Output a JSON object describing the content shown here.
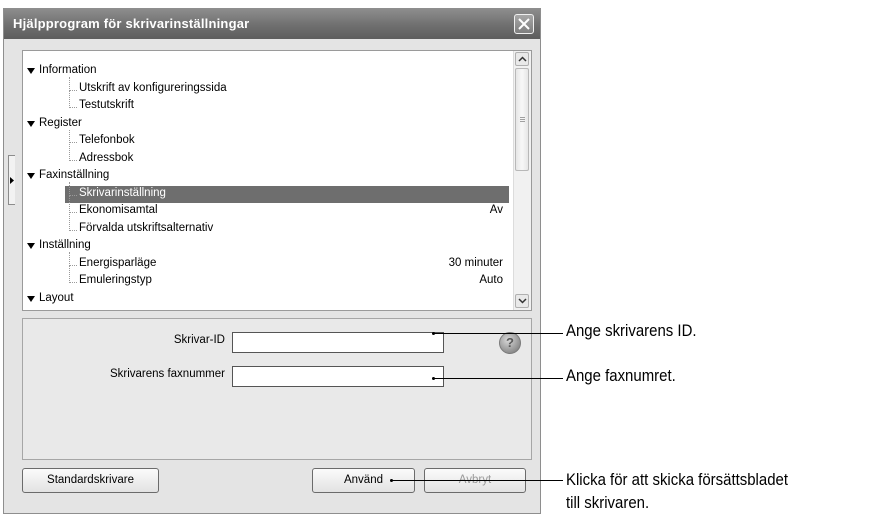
{
  "window": {
    "title": "Hjälpprogram för skrivarinställningar"
  },
  "tree": {
    "items": [
      {
        "label": "Information",
        "value": "",
        "level": 0
      },
      {
        "label": "Utskrift av konfigureringssida",
        "value": "",
        "level": 1
      },
      {
        "label": "Testutskrift",
        "value": "",
        "level": 1
      },
      {
        "label": "Register",
        "value": "",
        "level": 0
      },
      {
        "label": "Telefonbok",
        "value": "",
        "level": 1
      },
      {
        "label": "Adressbok",
        "value": "",
        "level": 1
      },
      {
        "label": "Faxinställning",
        "value": "",
        "level": 0
      },
      {
        "label": "Skrivarinställning",
        "value": "",
        "level": 1,
        "selected": true
      },
      {
        "label": "Ekonomisamtal",
        "value": "Av",
        "level": 1
      },
      {
        "label": "Förvalda utskriftsalternativ",
        "value": "",
        "level": 1
      },
      {
        "label": "Inställning",
        "value": "",
        "level": 0
      },
      {
        "label": "Energisparläge",
        "value": "30 minuter",
        "level": 1
      },
      {
        "label": "Emuleringstyp",
        "value": "Auto",
        "level": 1
      },
      {
        "label": "Layout",
        "value": "",
        "level": 0
      }
    ]
  },
  "form": {
    "printer_id_label": "Skrivar-ID",
    "printer_id_value": "",
    "fax_number_label": "Skrivarens faxnummer",
    "fax_number_value": ""
  },
  "buttons": {
    "default_printer": "Standardskrivare",
    "apply": "Använd",
    "cancel": "Avbryt"
  },
  "callouts": {
    "printer_id": "Ange skrivarens ID.",
    "fax_number": "Ange faxnumret.",
    "apply_line1": "Klicka för att skicka försättsbladet",
    "apply_line2": "till  skrivaren."
  }
}
